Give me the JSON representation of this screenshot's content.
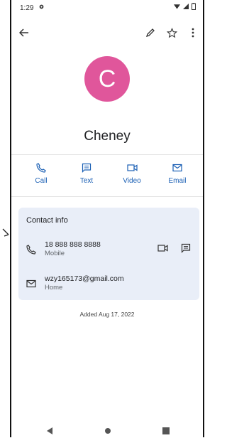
{
  "status_bar": {
    "time": "1:29"
  },
  "contact": {
    "initial": "C",
    "name": "Cheney",
    "avatar_color": "#e0569b"
  },
  "actions": [
    {
      "label": "Call",
      "icon": "phone-icon"
    },
    {
      "label": "Text",
      "icon": "message-icon"
    },
    {
      "label": "Video",
      "icon": "video-icon"
    },
    {
      "label": "Email",
      "icon": "mail-icon"
    }
  ],
  "contact_info": {
    "title": "Contact info",
    "phone": {
      "number": "18 888 888 8888",
      "type": "Mobile"
    },
    "email": {
      "address": "wzy165173@gmail.com",
      "type": "Home"
    }
  },
  "added_text": "Added Aug 17, 2022",
  "colors": {
    "accent": "#1a5fb4",
    "card_bg": "#e9eef8"
  }
}
